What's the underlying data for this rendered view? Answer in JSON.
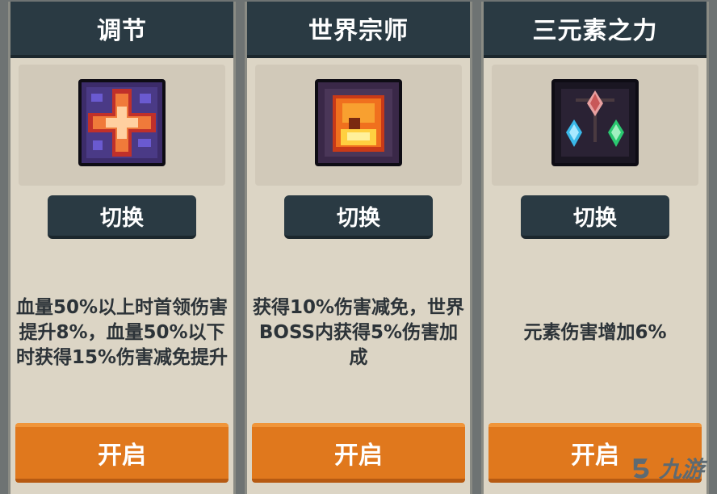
{
  "cards": [
    {
      "title": "调节",
      "icon": "cross-emblem-icon",
      "switch_label": "切换",
      "description": "血量50%以上时首领伤害提升8%，血量50%以下时获得15%伤害减免提升",
      "action_label": "开启"
    },
    {
      "title": "世界宗师",
      "icon": "fire-emblem-icon",
      "switch_label": "切换",
      "description": "获得10%伤害减免，世界BOSS内获得5%伤害加成",
      "action_label": "开启"
    },
    {
      "title": "三元素之力",
      "icon": "three-gems-icon",
      "switch_label": "切换",
      "description": "元素伤害增加6%",
      "action_label": "开启"
    }
  ],
  "watermark": "九游",
  "colors": {
    "header_bg": "#2a3a43",
    "card_bg": "#dcd5c5",
    "action_orange": "#e0781d",
    "text_dark": "#2c3338"
  }
}
